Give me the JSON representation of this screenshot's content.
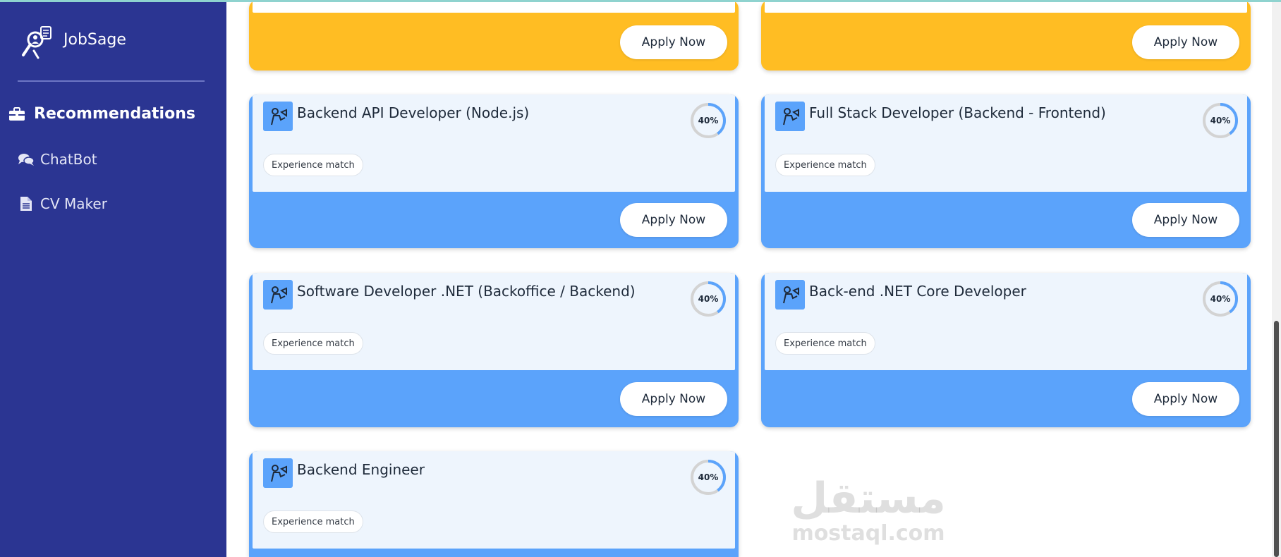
{
  "app": {
    "name": "JobSage"
  },
  "sidebar": {
    "items": [
      {
        "label": "Recommendations",
        "icon": "briefcase-icon",
        "active": true
      },
      {
        "label": "ChatBot",
        "icon": "chat-bubbles-icon",
        "active": false
      },
      {
        "label": "CV Maker",
        "icon": "document-icon",
        "active": false
      }
    ]
  },
  "colors": {
    "sidebar_bg": "#2b3592",
    "card_blue": "#5ba3fb",
    "card_yellow": "#ffbd23",
    "ring_progress": "#5ba3fb",
    "ring_track": "#d3d3d3"
  },
  "jobs": [
    {
      "title": "",
      "apply_label": "Apply Now",
      "color": "yellow"
    },
    {
      "title": "",
      "apply_label": "Apply Now",
      "color": "yellow"
    },
    {
      "title": "Backend API Developer (Node.js)",
      "match_percent": 40,
      "match_label": "40%",
      "badge": "Experience match",
      "apply_label": "Apply Now",
      "color": "blue",
      "icon": "job-avatar-icon"
    },
    {
      "title": "Full Stack Developer (Backend - Frontend)",
      "match_percent": 40,
      "match_label": "40%",
      "badge": "Experience match",
      "apply_label": "Apply Now",
      "color": "blue",
      "icon": "job-avatar-icon"
    },
    {
      "title": "Software Developer .NET (Backoffice / Backend)",
      "match_percent": 40,
      "match_label": "40%",
      "badge": "Experience match",
      "apply_label": "Apply Now",
      "color": "blue",
      "icon": "job-avatar-icon"
    },
    {
      "title": "Back-end .NET Core Developer",
      "match_percent": 40,
      "match_label": "40%",
      "badge": "Experience match",
      "apply_label": "Apply Now",
      "color": "blue",
      "icon": "job-avatar-icon"
    },
    {
      "title": "Backend Engineer",
      "match_percent": 40,
      "match_label": "40%",
      "badge": "Experience match",
      "color": "blue",
      "icon": "job-avatar-icon"
    }
  ],
  "watermark": {
    "logo": "مستقل",
    "text": "mostaql.com"
  }
}
